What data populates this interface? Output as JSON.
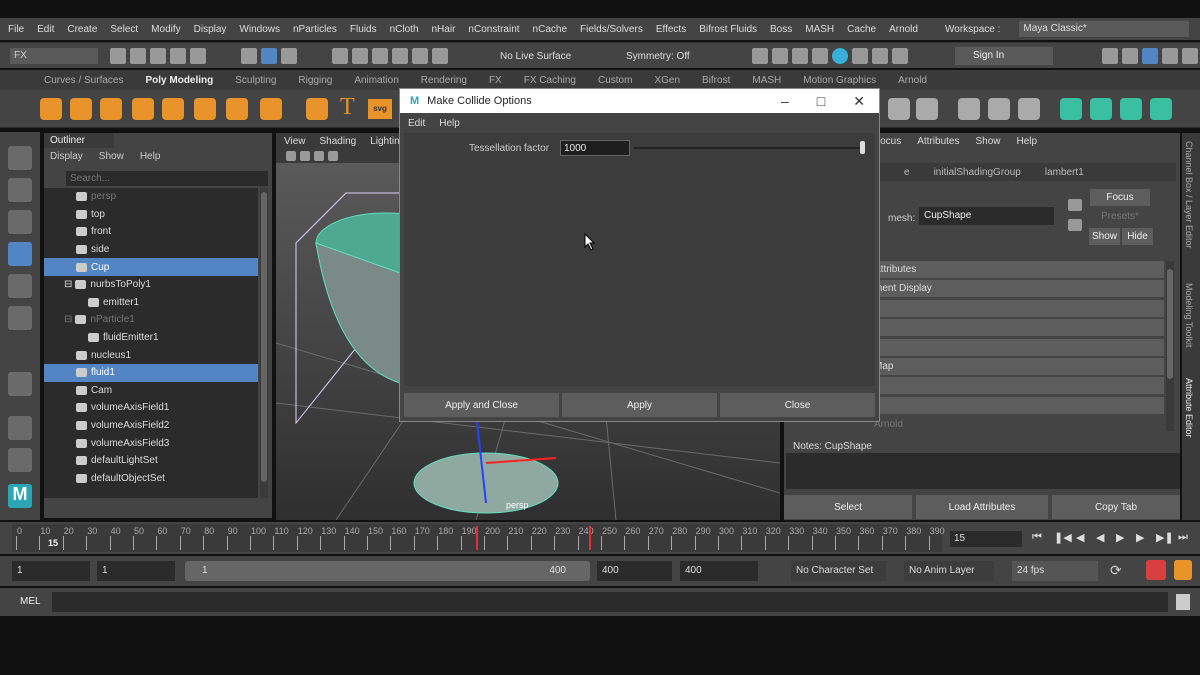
{
  "menubar": {
    "items": [
      "File",
      "Edit",
      "Create",
      "Select",
      "Modify",
      "Display",
      "Windows",
      "nParticles",
      "Fluids",
      "nCloth",
      "nHair",
      "nConstraint",
      "nCache",
      "Fields/Solvers",
      "Effects",
      "Bifrost Fluids",
      "Boss",
      "MASH",
      "Cache",
      "Arnold"
    ],
    "workspace_label": "Workspace :",
    "workspace_value": "Maya Classic*"
  },
  "status": {
    "menuset": "FX",
    "live_surface": "No Live Surface",
    "symmetry": "Symmetry: Off",
    "sign_in": "Sign In"
  },
  "shelf": {
    "tabs": [
      "Curves / Surfaces",
      "Poly Modeling",
      "Sculpting",
      "Rigging",
      "Animation",
      "Rendering",
      "FX",
      "FX Caching",
      "Custom",
      "XGen",
      "Bifrost",
      "MASH",
      "Motion Graphics",
      "Arnold"
    ],
    "active": "Poly Modeling",
    "text_icons": [
      "T",
      "svg"
    ]
  },
  "outliner": {
    "title": "Outliner",
    "menu": [
      "Display",
      "Show",
      "Help"
    ],
    "search_placeholder": "Search...",
    "items": [
      {
        "label": "persp",
        "icon": "camera-icon",
        "dim": true
      },
      {
        "label": "top",
        "icon": "camera-icon"
      },
      {
        "label": "front",
        "icon": "camera-icon"
      },
      {
        "label": "side",
        "icon": "camera-icon"
      },
      {
        "label": "Cup",
        "icon": "mesh-icon",
        "selected": true
      },
      {
        "label": "nurbsToPoly1",
        "icon": "mesh-icon",
        "expand": true
      },
      {
        "label": "emitter1",
        "icon": "emitter-icon",
        "child": true
      },
      {
        "label": "nParticle1",
        "icon": "particle-icon",
        "dim": true,
        "expand": true
      },
      {
        "label": "fluidEmitter1",
        "icon": "emitter-icon",
        "child": true
      },
      {
        "label": "nucleus1",
        "icon": "nucleus-icon"
      },
      {
        "label": "fluid1",
        "icon": "fluid-icon",
        "selected": true
      },
      {
        "label": "Cam",
        "icon": "camera-icon"
      },
      {
        "label": "volumeAxisField1",
        "icon": "field-icon"
      },
      {
        "label": "volumeAxisField2",
        "icon": "field-icon"
      },
      {
        "label": "volumeAxisField3",
        "icon": "field-icon"
      },
      {
        "label": "defaultLightSet",
        "icon": "set-icon"
      },
      {
        "label": "defaultObjectSet",
        "icon": "set-icon"
      }
    ]
  },
  "viewport": {
    "menu": [
      "View",
      "Shading",
      "Lighting"
    ],
    "camera_label": "persp"
  },
  "dialog": {
    "title": "Make Collide Options",
    "menu": [
      "Edit",
      "Help"
    ],
    "tess_label": "Tessellation factor",
    "tess_value": "1000",
    "buttons": [
      "Apply and Close",
      "Apply",
      "Close"
    ]
  },
  "attr_editor": {
    "menu": [
      "Focus",
      "Attributes",
      "Show",
      "Help"
    ],
    "tabs": [
      "e",
      "initialShadingGroup",
      "lambert1"
    ],
    "mesh_label": "mesh:",
    "mesh_value": "CupShape",
    "focus": "Focus",
    "presets": "Presets*",
    "show": "Show",
    "hide": "Hide",
    "sections": [
      "Attributes",
      "ment Display",
      "s",
      "e",
      "s",
      "Map",
      "",
      "y",
      "Arnold"
    ],
    "notes_label": "Notes: CupShape",
    "bottom_buttons": [
      "Select",
      "Load Attributes",
      "Copy Tab"
    ]
  },
  "side_tabs": [
    "Channel Box / Layer Editor",
    "Modeling Toolkit",
    "Attribute Editor"
  ],
  "timeline": {
    "ticks": [
      "0",
      "10",
      "20",
      "30",
      "40",
      "50",
      "60",
      "70",
      "80",
      "90",
      "100",
      "110",
      "120",
      "130",
      "140",
      "150",
      "160",
      "170",
      "180",
      "190",
      "200",
      "210",
      "220",
      "230",
      "240",
      "250",
      "260",
      "270",
      "280",
      "290",
      "300",
      "310",
      "320",
      "330",
      "340",
      "350",
      "360",
      "370",
      "380",
      "390"
    ],
    "current_frame": "15",
    "current_field": "15"
  },
  "range": {
    "start": "1",
    "playback_start": "1",
    "slider_start": "1",
    "slider_end": "400",
    "playback_end": "400",
    "end": "400",
    "character_set": "No Character Set",
    "anim_layer": "No Anim Layer",
    "fps": "24 fps"
  },
  "cmdline": {
    "label": "MEL"
  },
  "colors": {
    "selection": "#5285c4",
    "accent_orange": "#e8942a",
    "wire": "#5fe0c0",
    "keyframe_red": "#e0303a"
  }
}
